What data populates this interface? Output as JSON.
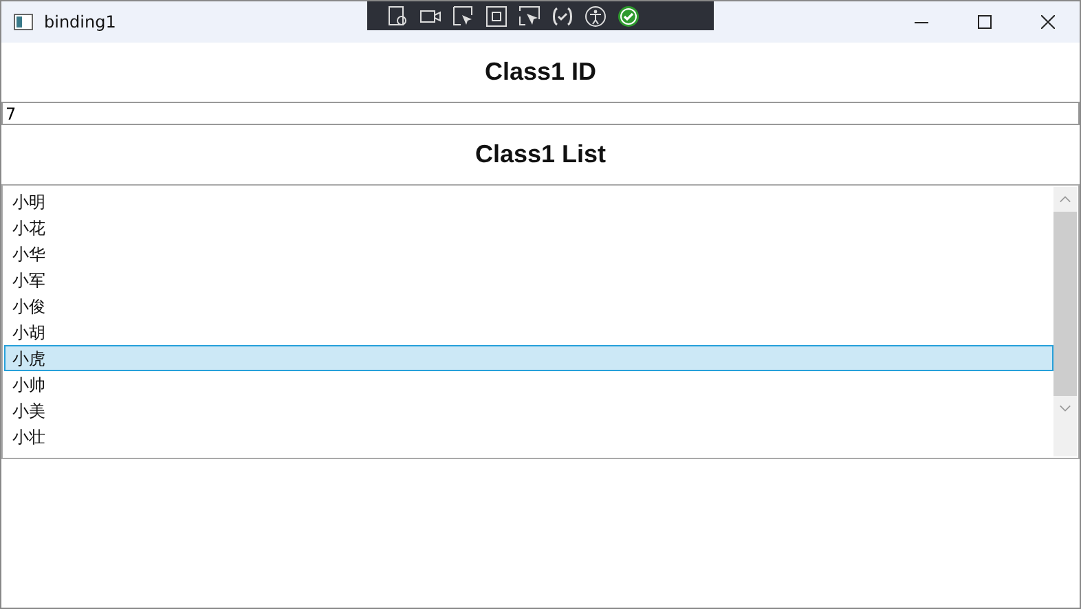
{
  "window": {
    "title": "binding1"
  },
  "id_heading": "Class1 ID",
  "id_field": {
    "value": "7"
  },
  "list_heading": "Class1 List",
  "list_items": [
    {
      "name": "小明",
      "selected": false
    },
    {
      "name": "小花",
      "selected": false
    },
    {
      "name": "小华",
      "selected": false
    },
    {
      "name": "小军",
      "selected": false
    },
    {
      "name": "小俊",
      "selected": false
    },
    {
      "name": "小胡",
      "selected": false
    },
    {
      "name": "小虎",
      "selected": true
    },
    {
      "name": "小帅",
      "selected": false
    },
    {
      "name": "小美",
      "selected": false
    },
    {
      "name": "小壮",
      "selected": false
    }
  ]
}
